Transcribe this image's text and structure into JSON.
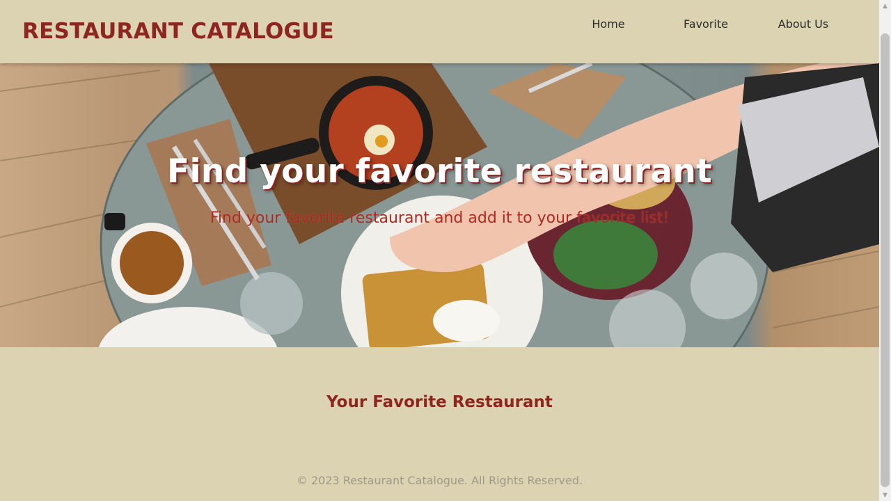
{
  "header": {
    "brand": "RESTAURANT CATALOGUE",
    "nav": [
      {
        "label": "Home"
      },
      {
        "label": "Favorite"
      },
      {
        "label": "About Us"
      }
    ]
  },
  "hero": {
    "title": "Find your favorite restaurant",
    "subtitle": "Find your favorite restaurant and add it to your favorite list!"
  },
  "main": {
    "section_title": "Your Favorite Restaurant"
  },
  "footer": {
    "text": "© 2023 Restaurant Catalogue. All Rights Reserved."
  },
  "colors": {
    "background": "#dcd3b2",
    "brand": "#8f2520",
    "subtitle": "#b02820",
    "footer_text": "#9f9a88"
  },
  "icons": {
    "scroll_up": "scroll-up-arrow-icon",
    "scroll_down": "scroll-down-arrow-icon"
  }
}
